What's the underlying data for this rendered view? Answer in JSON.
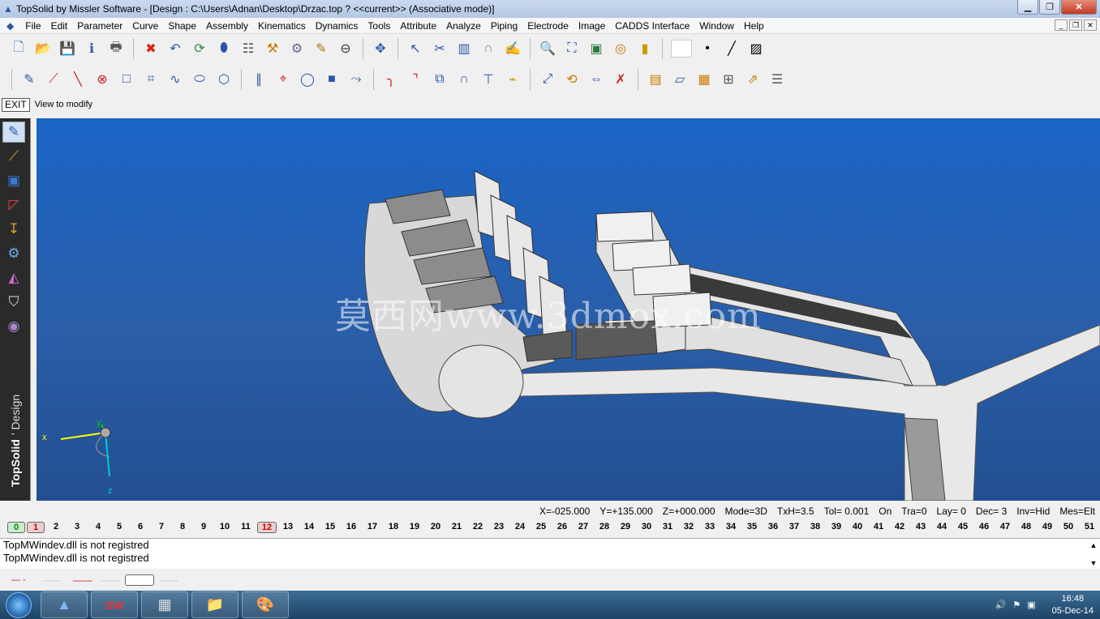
{
  "window": {
    "title": "TopSolid by Missler Software - [Design : C:\\Users\\Adnan\\Desktop\\Drzac.top ?  <<current>> (Associative mode)]"
  },
  "menu": [
    "File",
    "Edit",
    "Parameter",
    "Curve",
    "Shape",
    "Assembly",
    "Kinematics",
    "Dynamics",
    "Tools",
    "Attribute",
    "Analyze",
    "Piping",
    "Electrode",
    "Image",
    "CADDS Interface",
    "Window",
    "Help"
  ],
  "prompt": {
    "exit_label": "EXIT",
    "text": "View to modify"
  },
  "sidebar": {
    "brand": "TopSolid",
    "brand_sub": "' Design"
  },
  "viewport": {
    "watermark": "莫西网www.3dmox.com",
    "axes": {
      "x": "x",
      "y": "y",
      "z": "z"
    }
  },
  "status": [
    "X=-025.000",
    "Y=+135.000",
    "Z=+000.000",
    "Mode=3D",
    "TxH=3.5",
    "Tol= 0.001",
    "On",
    "Tra=0",
    "Lay= 0",
    "Dec= 3",
    "Inv=Hid",
    "Mes=Elt"
  ],
  "layers": {
    "first": [
      "0",
      "1"
    ],
    "numbers": [
      "2",
      "3",
      "4",
      "5",
      "6",
      "7",
      "8",
      "9",
      "10",
      "11",
      "12",
      "13",
      "14",
      "15",
      "16",
      "17",
      "18",
      "19",
      "20",
      "21",
      "22",
      "23",
      "24",
      "25",
      "26",
      "27",
      "28",
      "29",
      "30",
      "31",
      "32",
      "33",
      "34",
      "35",
      "36",
      "37",
      "38",
      "39",
      "40",
      "41",
      "42",
      "43",
      "44",
      "45",
      "46",
      "47",
      "48",
      "49",
      "50",
      "51"
    ]
  },
  "messages": [
    "TopMWindev.dll is not registred",
    "TopMWindev.dll is not registred"
  ],
  "taskbar": {
    "time": "16:48",
    "date": "05-Dec-14"
  }
}
